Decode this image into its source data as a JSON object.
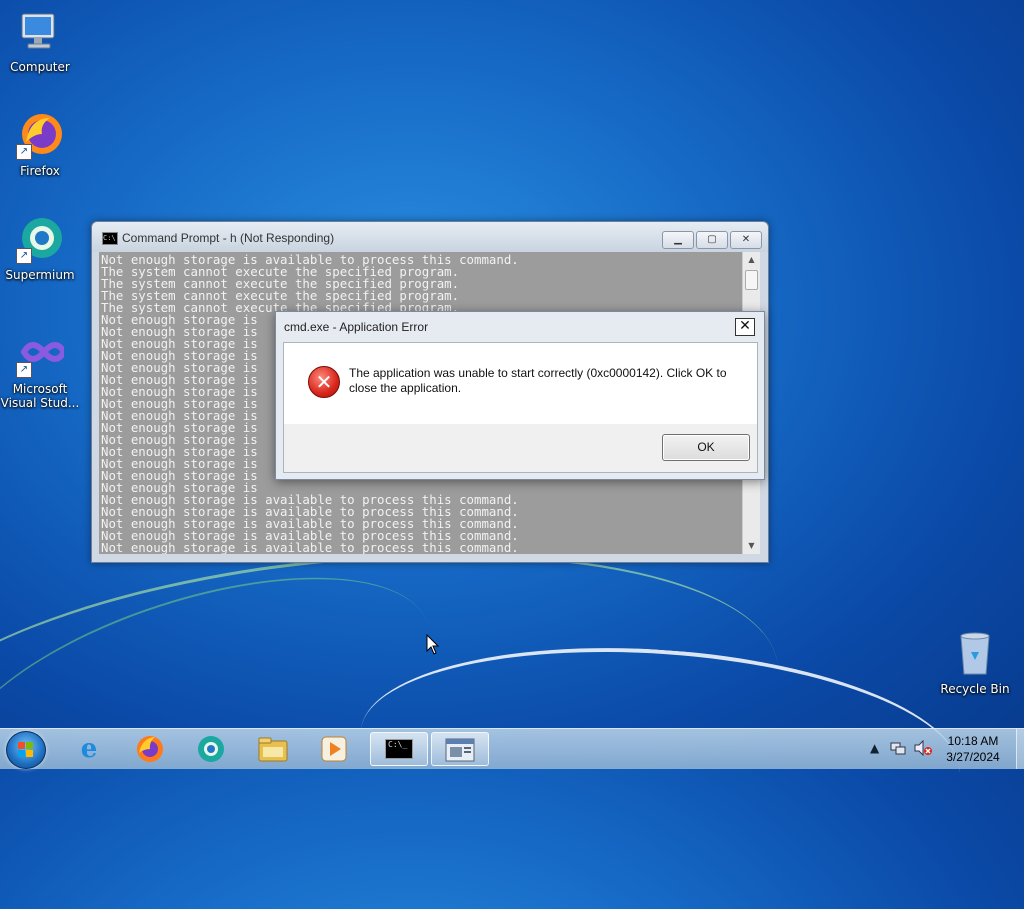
{
  "desktop": {
    "icons": [
      {
        "label": "Computer",
        "icon": "computer-icon"
      },
      {
        "label": "Firefox",
        "icon": "firefox-icon"
      },
      {
        "label": "Supermium",
        "icon": "supermium-icon"
      },
      {
        "label": "Microsoft Visual Stud...",
        "icon": "visual-studio-icon"
      },
      {
        "label": "Recycle Bin",
        "icon": "recycle-bin-icon"
      }
    ]
  },
  "cmd_window": {
    "title": "Command Prompt - h (Not Responding)",
    "lines": [
      "Not enough storage is available to process this command.",
      "The system cannot execute the specified program.",
      "The system cannot execute the specified program.",
      "The system cannot execute the specified program.",
      "The system cannot execute the specified program.",
      "Not enough storage is",
      "Not enough storage is",
      "Not enough storage is",
      "Not enough storage is",
      "Not enough storage is",
      "Not enough storage is",
      "Not enough storage is",
      "Not enough storage is",
      "Not enough storage is",
      "Not enough storage is",
      "Not enough storage is",
      "Not enough storage is",
      "Not enough storage is",
      "Not enough storage is",
      "Not enough storage is",
      "Not enough storage is available to process this command.",
      "Not enough storage is available to process this command.",
      "Not enough storage is available to process this command.",
      "Not enough storage is available to process this command.",
      "Not enough storage is available to process this command."
    ],
    "text_color": "#f2f2f2",
    "background_color": "#9c9c9c"
  },
  "error_dialog": {
    "title": "cmd.exe - Application Error",
    "message": "The application was unable to start correctly (0xc0000142). Click OK to close the application.",
    "ok_label": "OK",
    "close_glyph": "✕",
    "icon": "error-icon",
    "icon_glyph": "✕"
  },
  "taskbar": {
    "pinned": [
      {
        "icon": "internet-explorer-icon",
        "glyph": "e",
        "color": "#1b8be0"
      },
      {
        "icon": "firefox-icon",
        "glyph": "●",
        "color": "#ff7a1a"
      },
      {
        "icon": "supermium-icon",
        "glyph": "●",
        "color": "#2aa29a"
      },
      {
        "icon": "file-explorer-icon",
        "glyph": "▤",
        "color": "#e8c050"
      },
      {
        "icon": "media-player-icon",
        "glyph": "▶",
        "color": "#f08020"
      },
      {
        "icon": "command-prompt-icon",
        "glyph": "C:\\_",
        "color": "#000000"
      },
      {
        "icon": "application-window-icon",
        "glyph": "▣",
        "color": "#556677"
      }
    ],
    "clock_time": "10:18 AM",
    "clock_date": "3/27/2024"
  }
}
